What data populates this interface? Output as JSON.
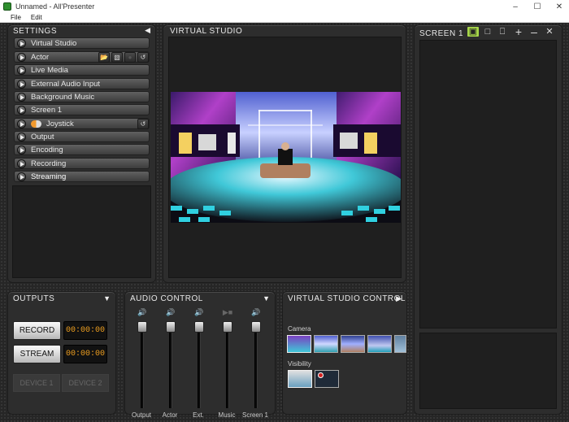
{
  "window": {
    "title": "Unnamed - All'Presenter"
  },
  "menu": [
    "File",
    "Edit"
  ],
  "settings": {
    "title": "SETTINGS",
    "items": [
      "Virtual Studio",
      "Actor",
      "Live Media",
      "External Audio Input",
      "Background Music",
      "Screen 1",
      "Joystick",
      "Output",
      "Encoding",
      "Recording",
      "Streaming"
    ]
  },
  "virtual_studio": {
    "title": "VIRTUAL STUDIO"
  },
  "screen": {
    "title": "SCREEN 1"
  },
  "outputs": {
    "title": "OUTPUTS",
    "record_label": "RECORD",
    "record_time": "00:00:00",
    "stream_label": "STREAM",
    "stream_time": "00:00:00",
    "device1_label": "DEVICE 1",
    "device2_label": "DEVICE 2"
  },
  "audio": {
    "title": "AUDIO CONTROL",
    "channels": [
      "Output",
      "Actor",
      "Ext.",
      "Music",
      "Screen 1"
    ]
  },
  "vs_control": {
    "title": "VIRTUAL STUDIO CONTROL",
    "camera_label": "Camera",
    "visibility_label": "Visibility"
  },
  "colors": {
    "accent": "#a8d84a",
    "timer": "#f0a020",
    "panel": "#2d2d2d"
  },
  "icons": {
    "window_controls": [
      "minimize-icon",
      "maximize-icon",
      "close-icon"
    ]
  }
}
